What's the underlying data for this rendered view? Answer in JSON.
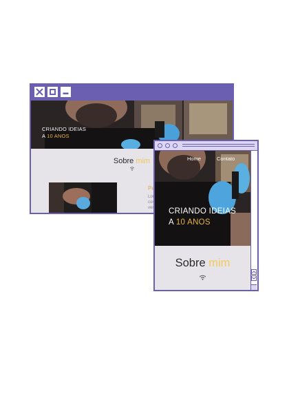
{
  "colors": {
    "frame": "#6a5fb0",
    "frame_light": "#ddd6f2",
    "accent_gold": "#e5b340",
    "accent_yellow": "#f2c95e",
    "page_bg": "#e6e4e8"
  },
  "desktop": {
    "window_buttons": [
      "close-icon",
      "maximize-icon",
      "minimize-icon"
    ],
    "hero": {
      "line1": "CRIANDO IDEIAS",
      "line2_prefix": "A ",
      "line2_highlight": "10 ANOS"
    },
    "section": {
      "title_main": "Sobre ",
      "title_sub": "mim"
    },
    "side": {
      "title": "Pe",
      "text": [
        "Lor",
        "con",
        "ven"
      ]
    }
  },
  "mobile": {
    "nav": {
      "home": "Home",
      "contact": "Contato"
    },
    "hero": {
      "line1": "CRIANDO IDEIAS",
      "line2_prefix": "A ",
      "line2_highlight": "10 ANOS"
    },
    "section": {
      "title_main": "Sobre ",
      "title_sub": "mim"
    },
    "scroll": {
      "up_icon": "chevron-up-icon",
      "down_icon": "chevron-down-icon"
    }
  }
}
